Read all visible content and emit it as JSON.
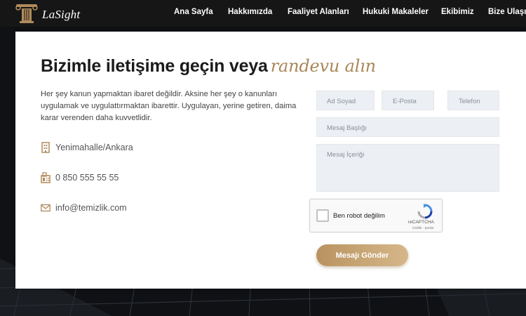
{
  "header": {
    "brand": "LaSight",
    "nav": [
      "Ana Sayfa",
      "Hakkımızda",
      "Faaliyet Alanları",
      "Hukuki Makaleler",
      "Ekibimiz",
      "Bize Ulaşın"
    ]
  },
  "contact": {
    "title": "Bizimle iletişime geçin veya",
    "title_accent": "randevu alın",
    "description": "Her şey kanun yapmaktan ibaret değildir. Aksine her şey o kanunları uygulamak ve uygulattırmaktan ibarettir. Uygulayan, yerine getiren, daima karar verenden daha kuvvetlidir.",
    "address": "Yenimahalle/Ankara",
    "phone": "0 850 555 55 55",
    "email": "info@temizlik.com"
  },
  "form": {
    "name_placeholder": "Ad Soyad",
    "email_placeholder": "E-Posta",
    "phone_placeholder": "Telefon",
    "subject_placeholder": "Mesaj Başlığı",
    "message_placeholder": "Mesaj İçeriği",
    "captcha_label": "Ben robot değilim",
    "captcha_brand": "reCAPTCHA",
    "captcha_links": "Gizlilik - Şartlar",
    "submit_label": "Mesajı Gönder"
  },
  "colors": {
    "accent": "#a98758",
    "button_start": "#b9935f",
    "button_end": "#d6b78a",
    "field_bg": "#eceff4",
    "header_bg": "#161616"
  }
}
